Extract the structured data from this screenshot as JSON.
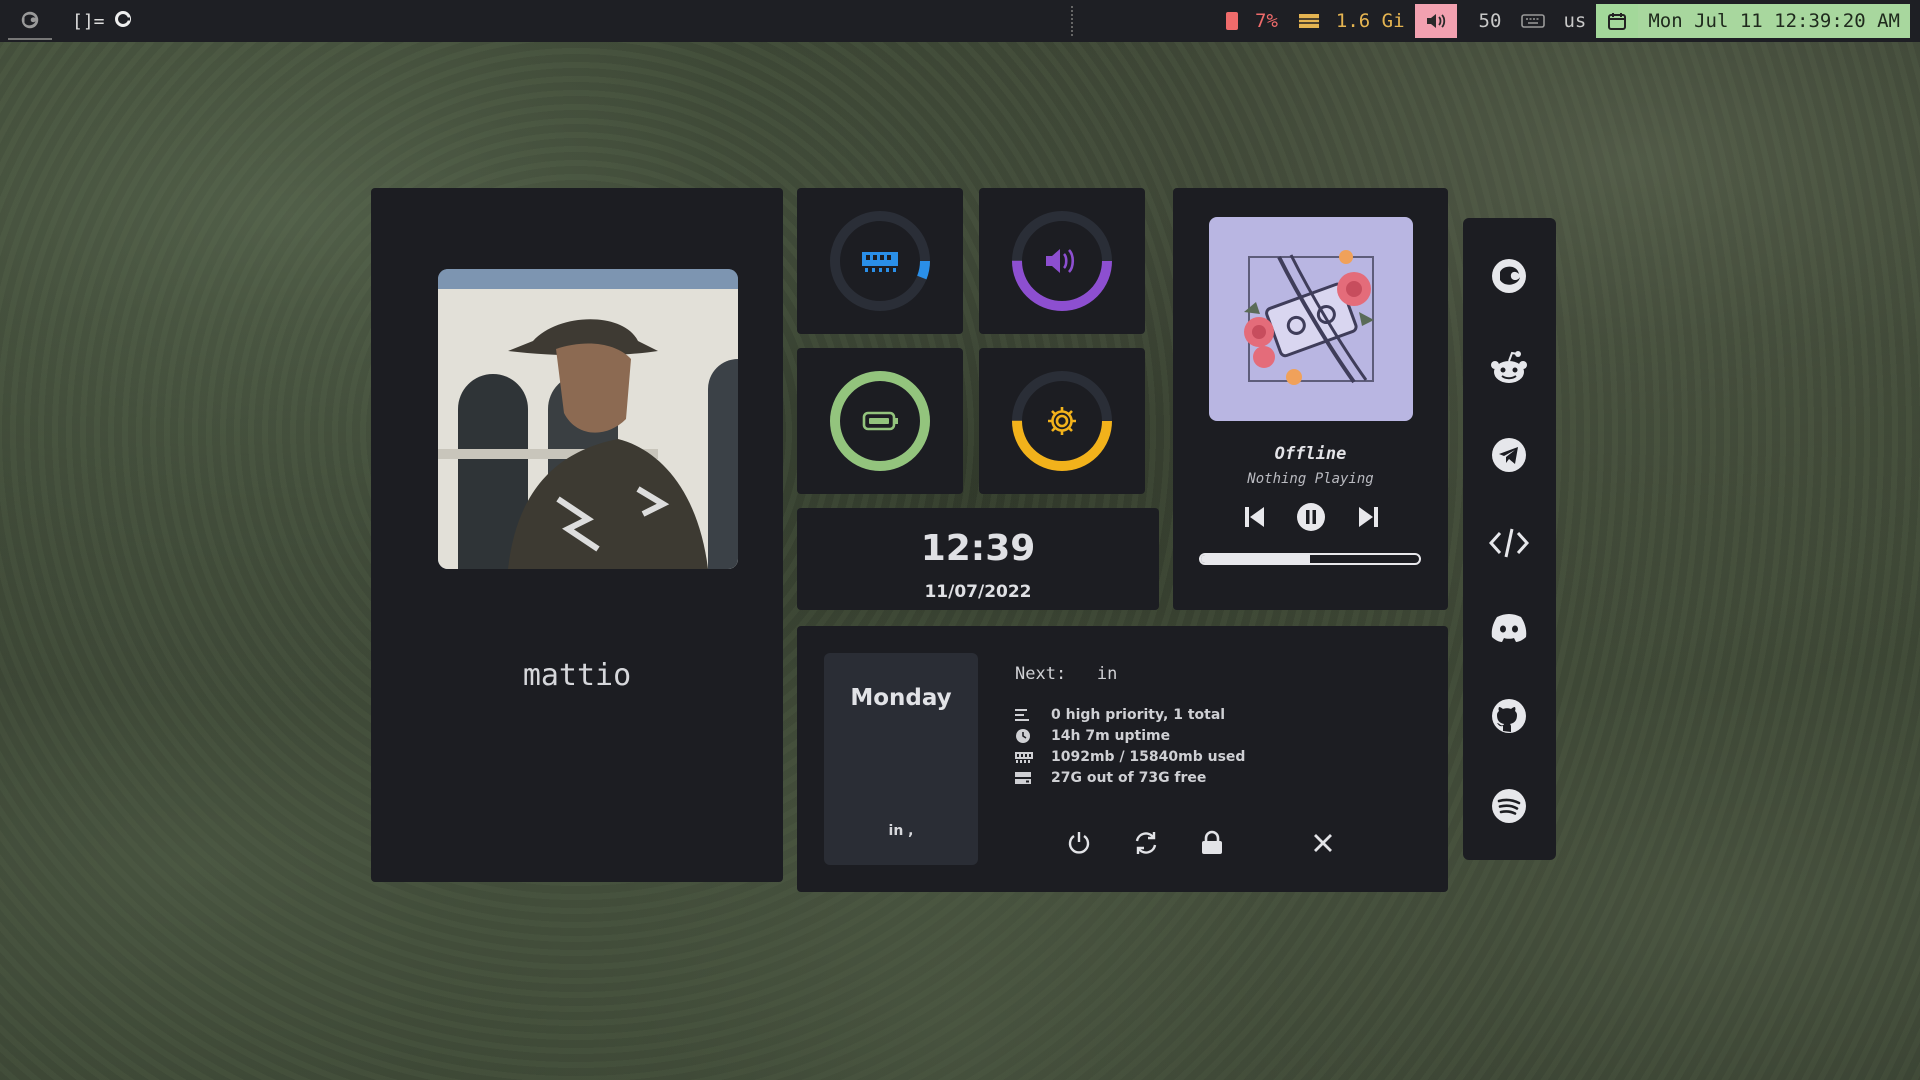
{
  "topbar": {
    "layout_symbol": "[]=",
    "cpu_text": "7%",
    "mem_text": "1.6 Gi",
    "volume_text": "50",
    "keyboard_layout": "us",
    "datetime": "Mon Jul 11 12:39:20 AM",
    "icons": [
      "firefox-icon",
      "layout-glyph-icon",
      "cpu-icon",
      "memory-icon",
      "speaker-icon",
      "keyboard-icon",
      "calendar-icon"
    ]
  },
  "profile": {
    "username": "mattio"
  },
  "gauges": {
    "ram": {
      "level": 0.06,
      "color": "#2a8fe8",
      "icon": "ram-icon"
    },
    "volume": {
      "level": 0.5,
      "color": "#8d4fd0",
      "icon": "speaker-icon"
    },
    "battery": {
      "level": 1.0,
      "color": "#93c47d",
      "icon": "battery-icon"
    },
    "brightness": {
      "level": 0.5,
      "color": "#f2b21b",
      "icon": "gear-icon"
    }
  },
  "clock": {
    "time": "12:39",
    "date": "11/07/2022"
  },
  "music": {
    "title": "Offline",
    "subtitle": "Nothing Playing",
    "progress": 0.5,
    "cover_color": "#b9b6e2"
  },
  "info": {
    "day_name": "Monday",
    "day_sub": "in ,",
    "next_label": "Next:   in",
    "stats": [
      {
        "icon": "list-icon",
        "text": "0 high priority, 1 total"
      },
      {
        "icon": "clock-icon",
        "text": "14h 7m uptime"
      },
      {
        "icon": "ram-icon",
        "text": "1092mb / 15840mb used"
      },
      {
        "icon": "disk-icon",
        "text": "27G out of 73G free"
      }
    ]
  },
  "dock": [
    "firefox-icon",
    "reddit-icon",
    "telegram-icon",
    "code-icon",
    "discord-icon",
    "github-icon",
    "spotify-icon"
  ]
}
